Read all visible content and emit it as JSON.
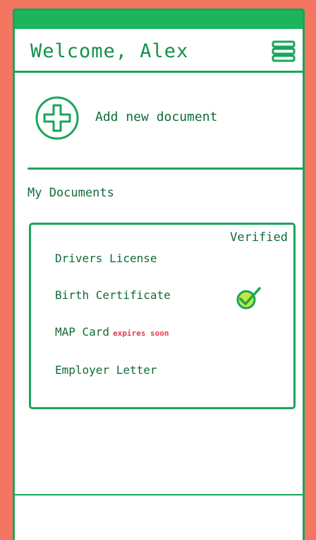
{
  "header": {
    "title": "Welcome, Alex",
    "menu_icon": "hamburger-menu-icon"
  },
  "add_document": {
    "icon": "plus-circle-icon",
    "label": "Add new document"
  },
  "documents": {
    "title": "My Documents",
    "verified_label": "Verified",
    "items": [
      {
        "name": "Drivers License",
        "verified": false,
        "note": ""
      },
      {
        "name": "Birth Certificate",
        "verified": true,
        "note": ""
      },
      {
        "name": "MAP Card",
        "verified": false,
        "note": "expires soon"
      },
      {
        "name": "Employer Letter",
        "verified": false,
        "note": ""
      }
    ]
  },
  "colors": {
    "background": "#f47560",
    "accent": "#1aa55a",
    "text": "#116b39",
    "warning": "#e8384f",
    "check": "#c8e63c"
  }
}
